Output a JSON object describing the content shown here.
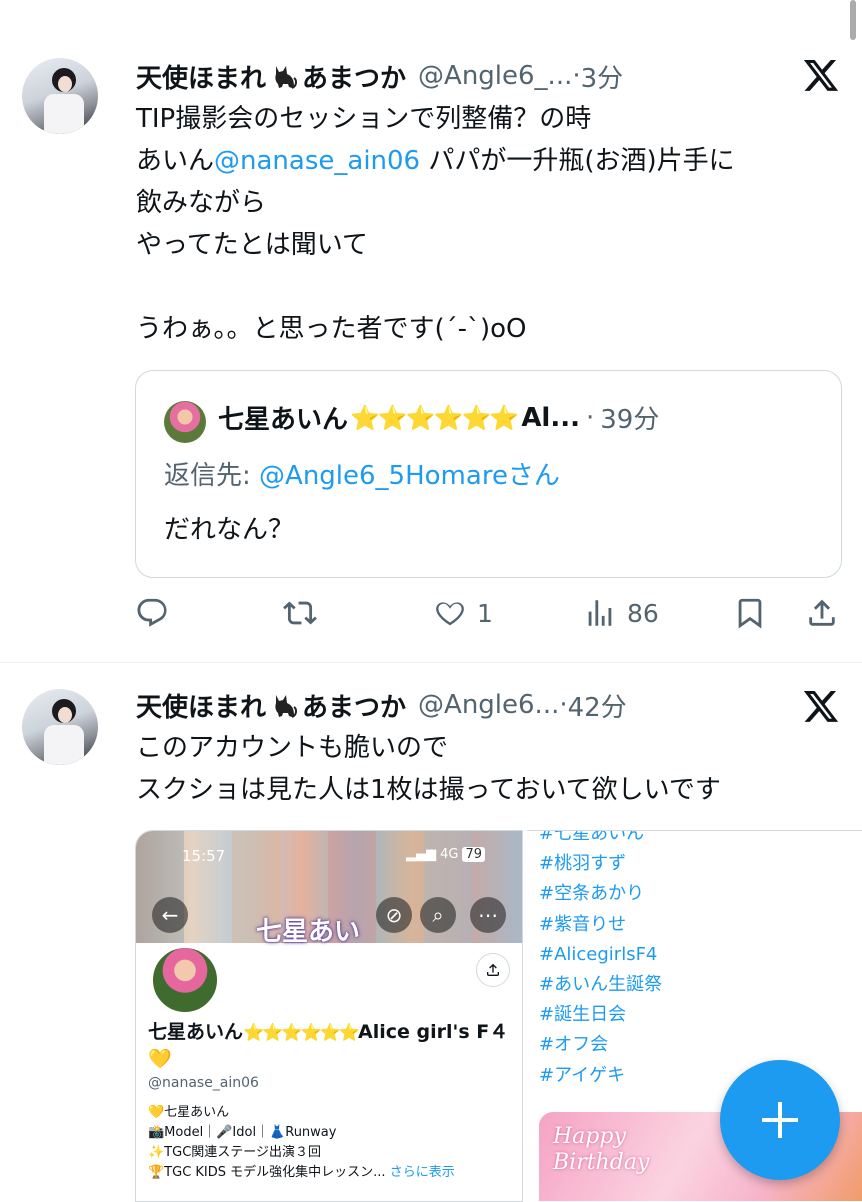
{
  "tweets": [
    {
      "name": "天使ほまれ",
      "name_suffix": "あまつか",
      "handle": "@Angle6_...",
      "dot": "·",
      "time": "3分",
      "text_line1": "TIP撮影会のセッションで列整備？の時",
      "text_line2_pre": "あいん",
      "mention": "@nanase_ain06",
      "text_line2_post": " パパが一升瓶(お酒)片手に",
      "text_rest": "飲みながら\nやってたとは聞いて\n\nうわぁ。。と思った者です(´-`)oO",
      "quote": {
        "name": "七星あいん",
        "stars": "⭐⭐⭐⭐⭐⭐",
        "trunc": "Al...",
        "dot": "·",
        "time": "39分",
        "reply_label": "返信先: ",
        "reply_handle": "@Angle6_5Homareさん",
        "text": "だれなん？"
      },
      "actions": {
        "reply_count": "",
        "retweet_count": "",
        "like_count": "1",
        "views_count": "86"
      }
    },
    {
      "name": "天使ほまれ",
      "name_suffix": "あまつか",
      "handle": "@Angle6...",
      "dot": "·",
      "time": "42分",
      "text": "このアカウントも脆いので\nスクショは見た人は1枚は撮っておいて欲しいです",
      "media_left": {
        "status_time": "15:57",
        "status_net": "4G",
        "status_battery": "79",
        "banner_title": "七星あい",
        "profile_name": "七星あいん",
        "profile_stars": "⭐⭐⭐⭐⭐⭐",
        "profile_name_suffix": "Alice girl's F４💛",
        "profile_handle": "@nanase_ain06",
        "bio": "💛七星あいん\n📸Model｜🎤Idol｜👗Runway\n✨TGC関連ステージ出演３回\n🏆TGC KIDS モデル強化集中レッスン...",
        "bio_more": "さらに表示"
      },
      "media_right": {
        "hashtags": "#七星あいん\n#桃羽すず\n#空条あかり\n#紫音りせ\n#AlicegirlsF4\n#あいん生誕祭\n#誕生日会\n#オフ会\n#アイゲキ",
        "card_text": "Happy\nBirthday"
      }
    }
  ],
  "colors": {
    "accent": "#1d9bf0",
    "muted": "#536471",
    "border": "#cfd9de"
  }
}
